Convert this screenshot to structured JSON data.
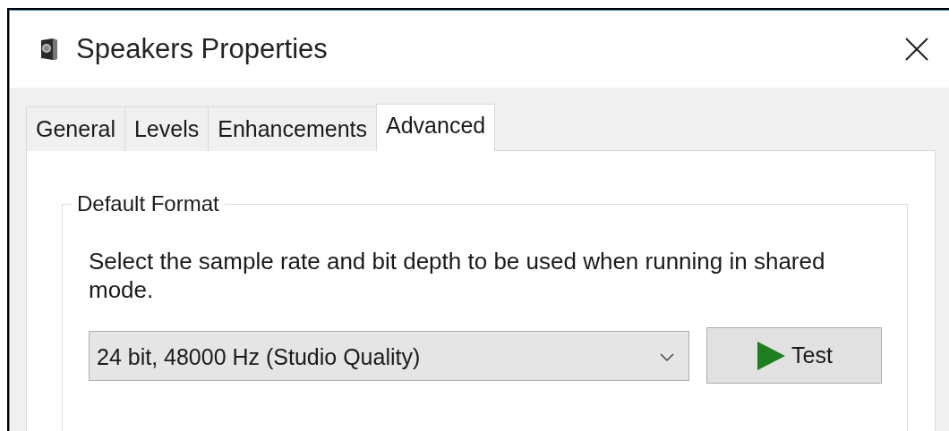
{
  "window": {
    "title": "Speakers Properties"
  },
  "tabs": [
    {
      "label": "General",
      "selected": false
    },
    {
      "label": "Levels",
      "selected": false
    },
    {
      "label": "Enhancements",
      "selected": false
    },
    {
      "label": "Advanced",
      "selected": true
    }
  ],
  "default_format": {
    "title": "Default Format",
    "description": "Select the sample rate and bit depth to be used when running in shared mode.",
    "format_select": {
      "value": "24 bit, 48000 Hz (Studio Quality)"
    },
    "test_button": {
      "label": "Test"
    }
  }
}
